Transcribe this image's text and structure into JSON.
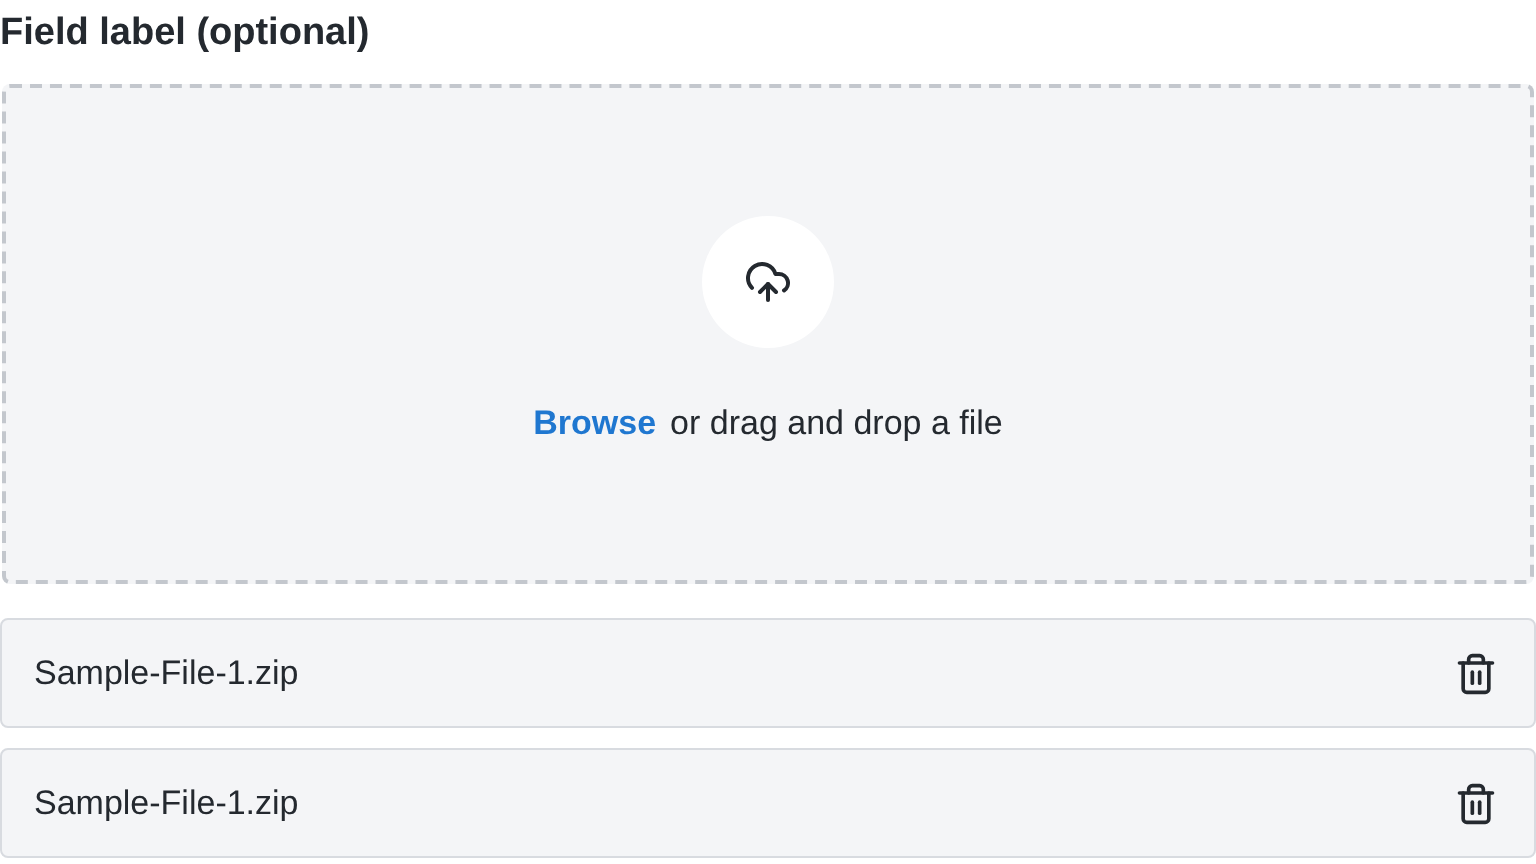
{
  "label": "Field label (optional)",
  "dropzone": {
    "link": "Browse",
    "text": "or drag and drop a file"
  },
  "files": [
    {
      "name": "Sample-File-1.zip"
    },
    {
      "name": "Sample-File-1.zip"
    }
  ]
}
